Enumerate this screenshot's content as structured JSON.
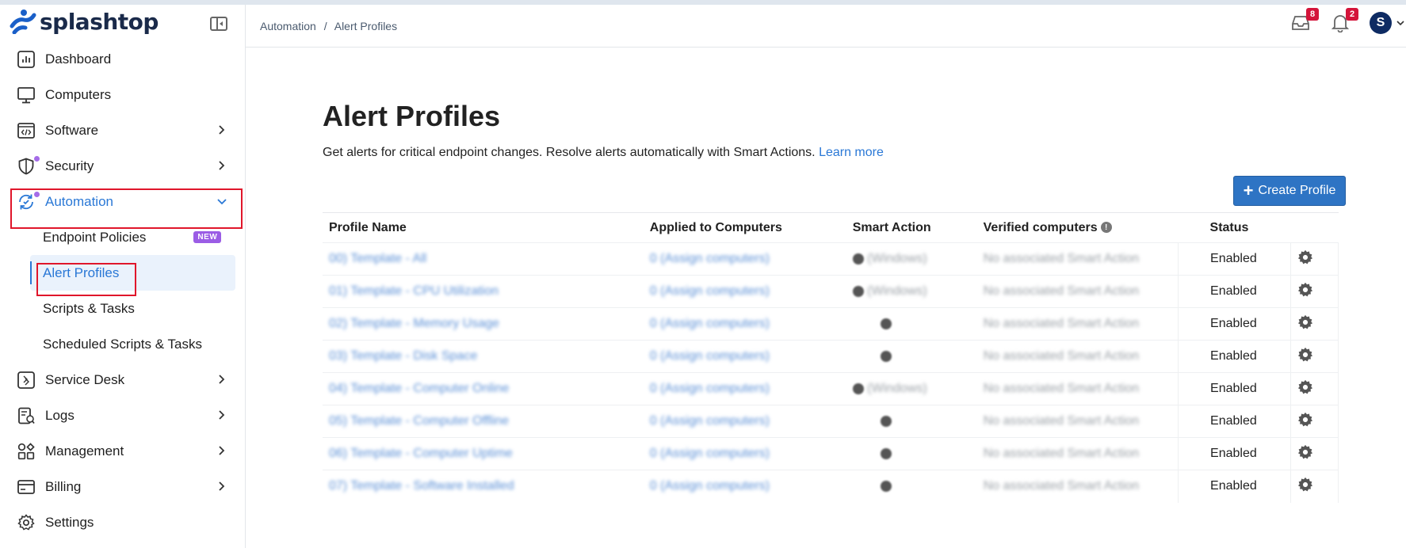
{
  "app": {
    "brand": "splashtop"
  },
  "sidebar": {
    "items": [
      {
        "label": "Dashboard",
        "icon": "dashboard-icon"
      },
      {
        "label": "Computers",
        "icon": "monitor-icon"
      },
      {
        "label": "Software",
        "icon": "code-window-icon"
      },
      {
        "label": "Security",
        "icon": "shield-icon"
      },
      {
        "label": "Automation",
        "icon": "automation-icon"
      },
      {
        "label": "Service Desk",
        "icon": "service-desk-icon"
      },
      {
        "label": "Logs",
        "icon": "logs-icon"
      },
      {
        "label": "Management",
        "icon": "management-icon"
      },
      {
        "label": "Billing",
        "icon": "billing-icon"
      },
      {
        "label": "Settings",
        "icon": "gear-icon"
      }
    ],
    "automation_sub": [
      {
        "label": "Endpoint Policies",
        "badge": "NEW"
      },
      {
        "label": "Alert Profiles"
      },
      {
        "label": "Scripts & Tasks"
      },
      {
        "label": "Scheduled Scripts & Tasks"
      }
    ]
  },
  "header": {
    "breadcrumb_1": "Automation",
    "breadcrumb_sep": "/",
    "breadcrumb_2": "Alert Profiles",
    "inbox_count": "8",
    "notification_count": "2",
    "avatar_initial": "S"
  },
  "main": {
    "title": "Alert Profiles",
    "subtitle": "Get alerts for critical endpoint changes. Resolve alerts automatically with Smart Actions.",
    "learn_more": "Learn more",
    "create_button": "Create Profile",
    "columns": [
      "Profile Name",
      "Applied to Computers",
      "Smart Action",
      "Verified computers",
      "Status"
    ],
    "rows": [
      {
        "name": "00) Template - All",
        "applied": "0 (Assign computers)",
        "smart": "(Windows)",
        "verified": "No associated Smart Action",
        "status": "Enabled"
      },
      {
        "name": "01) Template - CPU Utilization",
        "applied": "0 (Assign computers)",
        "smart": "(Windows)",
        "verified": "No associated Smart Action",
        "status": "Enabled"
      },
      {
        "name": "02) Template - Memory Usage",
        "applied": "0 (Assign computers)",
        "smart": "",
        "verified": "No associated Smart Action",
        "status": "Enabled"
      },
      {
        "name": "03) Template - Disk Space",
        "applied": "0 (Assign computers)",
        "smart": "",
        "verified": "No associated Smart Action",
        "status": "Enabled"
      },
      {
        "name": "04) Template - Computer Online",
        "applied": "0 (Assign computers)",
        "smart": "(Windows)",
        "verified": "No associated Smart Action",
        "status": "Enabled"
      },
      {
        "name": "05) Template - Computer Offline",
        "applied": "0 (Assign computers)",
        "smart": "",
        "verified": "No associated Smart Action",
        "status": "Enabled"
      },
      {
        "name": "06) Template - Computer Uptime",
        "applied": "0 (Assign computers)",
        "smart": "",
        "verified": "No associated Smart Action",
        "status": "Enabled"
      },
      {
        "name": "07) Template - Software Installed",
        "applied": "0 (Assign computers)",
        "smart": "",
        "verified": "No associated Smart Action",
        "status": "Enabled"
      }
    ]
  },
  "colors": {
    "accent": "#2a78d6",
    "highlight": "#e0162b",
    "button": "#2e74c4",
    "badge": "#d4143a",
    "new_badge": "#9b5de5"
  }
}
